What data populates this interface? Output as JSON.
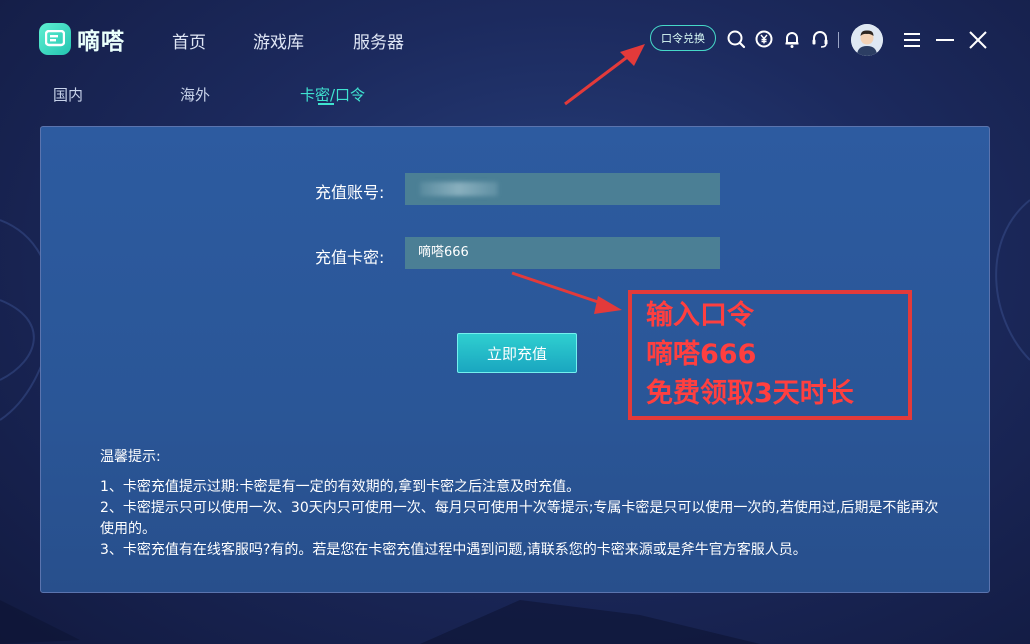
{
  "app": {
    "name": "嘀嗒"
  },
  "nav": [
    {
      "label": "首页"
    },
    {
      "label": "游戏库"
    },
    {
      "label": "服务器"
    }
  ],
  "header": {
    "redeem_button": "口令兑换",
    "icons": [
      "search-icon",
      "yuan-coin-icon",
      "bell-icon",
      "headset-icon",
      "menu-icon",
      "minimize-icon",
      "close-icon"
    ]
  },
  "subtabs": [
    {
      "label": "国内"
    },
    {
      "label": "海外"
    },
    {
      "label": "卡密/口令",
      "active": true
    }
  ],
  "form": {
    "account_label": "充值账号:",
    "account_value": "",
    "code_label": "充值卡密:",
    "code_value": "嘀嗒666",
    "submit_label": "立即充值"
  },
  "annotation": {
    "lines": [
      "输入口令",
      "嘀嗒666",
      "免费领取3天时长"
    ]
  },
  "tips": {
    "title": "温馨提示:",
    "items": [
      "1、卡密充值提示过期:卡密是有一定的有效期的,拿到卡密之后注意及时充值。",
      "2、卡密提示只可以使用一次、30天内只可使用一次、每月只可使用十次等提示;专属卡密是只可以使用一次的,若使用过,后期是不能再次使用的。",
      "3、卡密充值有在线客服吗?有的。若是您在卡密充值过程中遇到问题,请联系您的卡密来源或是斧牛官方客服人员。"
    ]
  },
  "colors": {
    "accent": "#3fe3d0",
    "annotation_red": "#e33a3a",
    "panel_bg": "#2d5ba0",
    "input_bg": "#4b7f95"
  }
}
